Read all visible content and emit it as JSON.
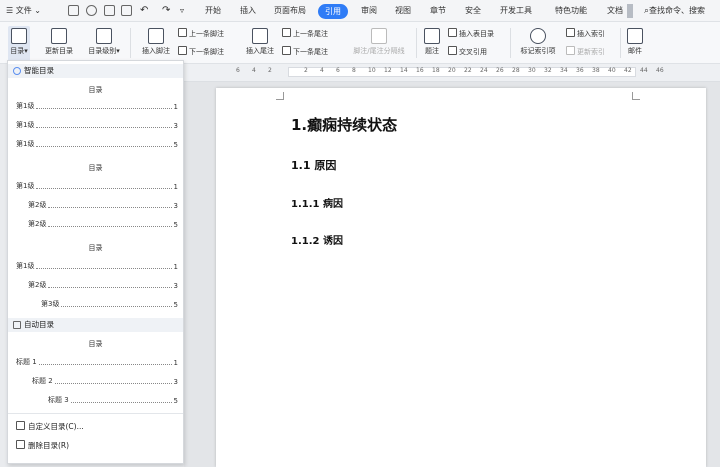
{
  "menubar": {
    "file": "文件",
    "tabs": [
      "开始",
      "插入",
      "页面布局",
      "引用",
      "审阅",
      "视图",
      "章节",
      "安全",
      "开发工具",
      "特色功能",
      "文档"
    ],
    "active_tab": "引用",
    "search": "查找命令、搜索"
  },
  "ribbon": {
    "toc": "目录",
    "update_toc": "更新目录",
    "toc_level": "目录级别",
    "insert_footnote": "插入脚注",
    "prev_footnote": "上一条脚注",
    "next_footnote": "下一条脚注",
    "insert_endnote": "插入尾注",
    "prev_endnote": "上一条尾注",
    "next_endnote": "下一条尾注",
    "note_separator": "脚注/尾注分隔线",
    "caption": "题注",
    "insert_table_toc": "插入表目录",
    "cross_ref": "交叉引用",
    "mark_index": "标记索引项",
    "insert_index": "插入索引",
    "update_index": "更新索引",
    "mail": "邮件"
  },
  "ruler": {
    "ticks": [
      "6",
      "4",
      "2",
      "2",
      "4",
      "6",
      "8",
      "10",
      "12",
      "14",
      "16",
      "18",
      "20",
      "22",
      "24",
      "26",
      "28",
      "30",
      "32",
      "34",
      "36",
      "38",
      "40",
      "42",
      "44",
      "46"
    ]
  },
  "toc_panel": {
    "smart_toc": "智能目录",
    "auto_toc": "自动目录",
    "preview_title": "目录",
    "preset1": [
      {
        "label": "第1级",
        "page": "1"
      },
      {
        "label": "第1级",
        "page": "3"
      },
      {
        "label": "第1级",
        "page": "5"
      }
    ],
    "preset2": [
      {
        "label": "第1级",
        "page": "1"
      },
      {
        "label": "第2级",
        "page": "3"
      },
      {
        "label": "第2级",
        "page": "5"
      }
    ],
    "preset3": [
      {
        "label": "第1级",
        "page": "1"
      },
      {
        "label": "第2级",
        "page": "3"
      },
      {
        "label": "第3级",
        "page": "5"
      }
    ],
    "auto": [
      {
        "label": "标题 1",
        "page": "1"
      },
      {
        "label": "标题 2",
        "page": "3"
      },
      {
        "label": "标题 3",
        "page": "5"
      }
    ],
    "custom_toc": "自定义目录(C)...",
    "delete_toc": "删除目录(R)"
  },
  "document": {
    "heading1": "1.癫痫持续状态",
    "heading2": "1.1 原因",
    "heading3a": "1.1.1 病因",
    "heading3b": "1.1.2 诱因"
  }
}
